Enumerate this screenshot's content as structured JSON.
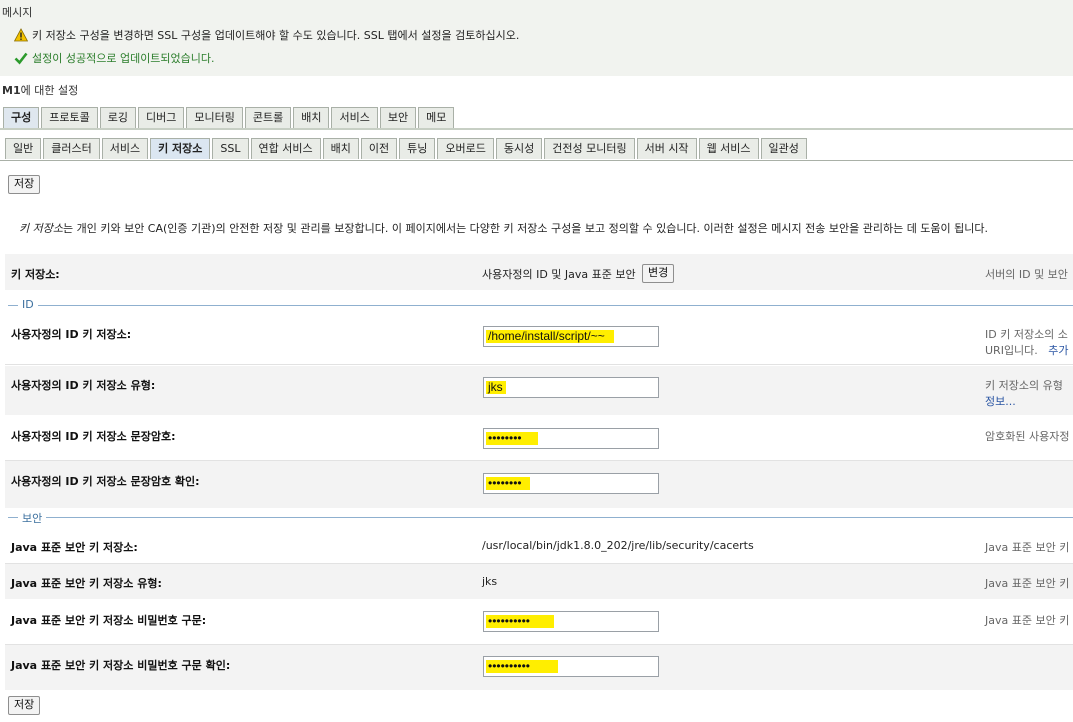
{
  "messages": {
    "title": "메시지",
    "warning": "키 저장소 구성을 변경하면 SSL 구성을 업데이트해야 할 수도 있습니다. SSL 탭에서 설정을 검토하십시오.",
    "success": "설정이 성공적으로 업데이트되었습니다."
  },
  "settings_title": "M1에 대한 설정",
  "tabs_main": [
    "구성",
    "프로토콜",
    "로깅",
    "디버그",
    "모니터링",
    "콘트롤",
    "배치",
    "서비스",
    "보안",
    "메모"
  ],
  "tabs_sub": [
    "일반",
    "클러스터",
    "서비스",
    "키 저장소",
    "SSL",
    "연합 서비스",
    "배치",
    "이전",
    "튜닝",
    "오버로드",
    "동시성",
    "건전성 모니터링",
    "서버 시작",
    "웹 서비스",
    "일관성"
  ],
  "buttons": {
    "save": "저장",
    "change": "변경"
  },
  "description": {
    "term": "키 저장소",
    "text": "는 개인 키와 보안 CA(인증 기관)의 안전한 저장 및 관리를 보장합니다. 이 페이지에서는 다양한 키 저장소 구성을 보고 정의할 수 있습니다. 이러한 설정은 메시지 전송 보안을 관리하는 데 도움이 됩니다."
  },
  "keystores": {
    "label": "키 저장소:",
    "value": "사용자정의 ID 및 Java 표준 보안",
    "help": "서버의 ID 및 보안"
  },
  "sections": {
    "identity": "ID",
    "trust": "보안"
  },
  "identity_rows": [
    {
      "label": "사용자정의 ID 키 저장소:",
      "value": "/home/install/script/~~",
      "help1": "ID 키 저장소의 소",
      "help2": "URI입니다.",
      "help_link": "추가"
    },
    {
      "label": "사용자정의 ID 키 저장소 유형:",
      "value": "jks",
      "help1": "키 저장소의 유형",
      "help_link": "정보..."
    },
    {
      "label": "사용자정의 ID 키 저장소 문장암호:",
      "value": "••••••••",
      "help1": "암호화된 사용자정"
    },
    {
      "label": "사용자정의 ID 키 저장소 문장암호 확인:",
      "value": "••••••••"
    }
  ],
  "trust_rows": [
    {
      "label": "Java 표준 보안 키 저장소:",
      "value": "/usr/local/bin/jdk1.8.0_202/jre/lib/security/cacerts",
      "help1": "Java 표준 보안 키"
    },
    {
      "label": "Java 표준 보안 키 저장소 유형:",
      "value": "jks",
      "help1": "Java 표준 보안 키"
    },
    {
      "label": "Java 표준 보안 키 저장소 비밀번호 구문:",
      "value": "••••••••••",
      "help1": "Java 표준 보안 키"
    },
    {
      "label": "Java 표준 보안 키 저장소 비밀번호 구문 확인:",
      "value": "••••••••••"
    }
  ],
  "colors": {
    "highlight": "#ffee00",
    "success": "#2a7d2a",
    "section": "#3b6f9e",
    "link": "#2a55a3"
  },
  "icons": {
    "warning": "warning-icon",
    "success": "checkmark-icon"
  }
}
